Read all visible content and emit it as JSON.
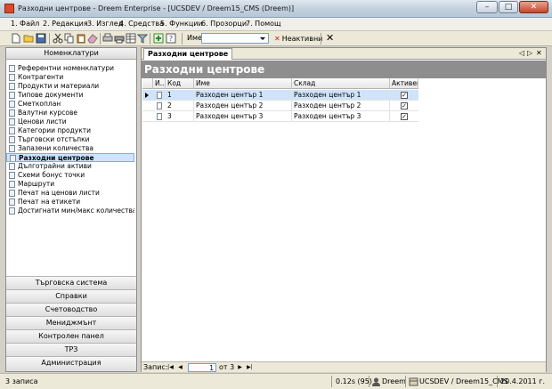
{
  "window": {
    "title": "Разходни центрове - Dreem Enterprise - [UCSDEV / Dreem15_CMS (Dreem)]",
    "controls": {
      "minimize": "–",
      "maximize": "□",
      "close": "✕"
    }
  },
  "menu": {
    "items": [
      {
        "label": "1. Файл"
      },
      {
        "label": "2. Редакция"
      },
      {
        "label": "3. Изглед"
      },
      {
        "label": "4. Средства"
      },
      {
        "label": "5. Функции"
      },
      {
        "label": "6. Прозорци"
      },
      {
        "label": "7. Помощ"
      }
    ]
  },
  "toolbar": {
    "icons": [
      "new-document-icon",
      "open-folder-icon",
      "save-icon",
      "cut-icon",
      "copy-icon",
      "paste-icon",
      "eraser-icon",
      "print-preview-icon",
      "print-icon",
      "grid-icon",
      "filter-icon",
      "refresh-icon",
      "help-icon"
    ],
    "name_label": "Име:",
    "name_value": "",
    "inactive_label": "Неактивни",
    "close_glyph": "✕"
  },
  "sidebar": {
    "header": "Номенклатури",
    "items": [
      {
        "label": "Референтни номенклатури"
      },
      {
        "label": "Контрагенти"
      },
      {
        "label": "Продукти и материали"
      },
      {
        "label": "Типове документи"
      },
      {
        "label": "Сметкоплан"
      },
      {
        "label": "Валутни курсове"
      },
      {
        "label": "Ценови листи"
      },
      {
        "label": "Категории продукти"
      },
      {
        "label": "Търговски отстъпки"
      },
      {
        "label": "Запазени количества"
      },
      {
        "label": "Разходни центрове",
        "selected": true
      },
      {
        "label": "Дълготрайни активи"
      },
      {
        "label": "Схеми бонус точки"
      },
      {
        "label": "Маршрути"
      },
      {
        "label": "Печат на ценови листи"
      },
      {
        "label": "Печат на етикети"
      },
      {
        "label": "Достигнати мин/макс количества..."
      }
    ],
    "sections": [
      {
        "label": "Търговска система"
      },
      {
        "label": "Справки"
      },
      {
        "label": "Счетоводство"
      },
      {
        "label": "Мениджмънт"
      },
      {
        "label": "Контролен панел"
      },
      {
        "label": "ТРЗ"
      },
      {
        "label": "Администрация"
      }
    ]
  },
  "main": {
    "tab_label": "Разходни центрове",
    "tab_controls": {
      "prev": "◁",
      "next": "▷",
      "close": "✕"
    },
    "title": "Разходни центрове",
    "grid": {
      "columns": [
        "И...",
        "Код",
        "Име",
        "Склад",
        "Активен"
      ],
      "rows": [
        {
          "code": "1",
          "name": "Разходен център 1",
          "warehouse": "Разходен център 1",
          "active": true
        },
        {
          "code": "2",
          "name": "Разходен център 2",
          "warehouse": "Разходен център 2",
          "active": true
        },
        {
          "code": "3",
          "name": "Разходен център 3",
          "warehouse": "Разходен център 3",
          "active": true
        }
      ]
    },
    "record_nav": {
      "label": "Запис:",
      "current": "1",
      "of_label": "от 3",
      "first": "|◀",
      "prev": "◀",
      "next": "▶",
      "last": "▶|"
    }
  },
  "status": {
    "records": "3 записа",
    "timing": "0.12s (95)",
    "app": "Dreem",
    "connection": "UCSDEV / Dreem15_CMS",
    "date": "20.4.2011 г."
  }
}
